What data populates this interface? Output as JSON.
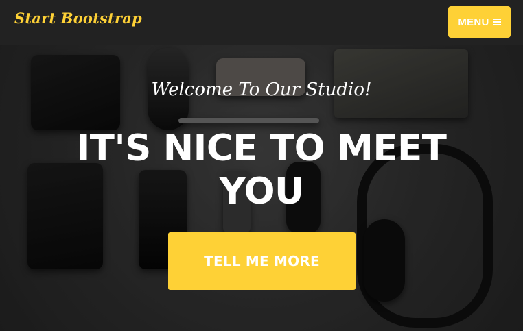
{
  "navbar": {
    "brand": "Start Bootstrap",
    "menu_label": "MENU",
    "menu_icon": "bars-icon"
  },
  "hero": {
    "subheading": "Welcome To Our Studio!",
    "heading": "IT'S NICE TO MEET YOU",
    "cta_label": "TELL ME MORE"
  },
  "colors": {
    "accent": "#fed136",
    "navbar_bg": "#222222",
    "text": "#ffffff"
  }
}
